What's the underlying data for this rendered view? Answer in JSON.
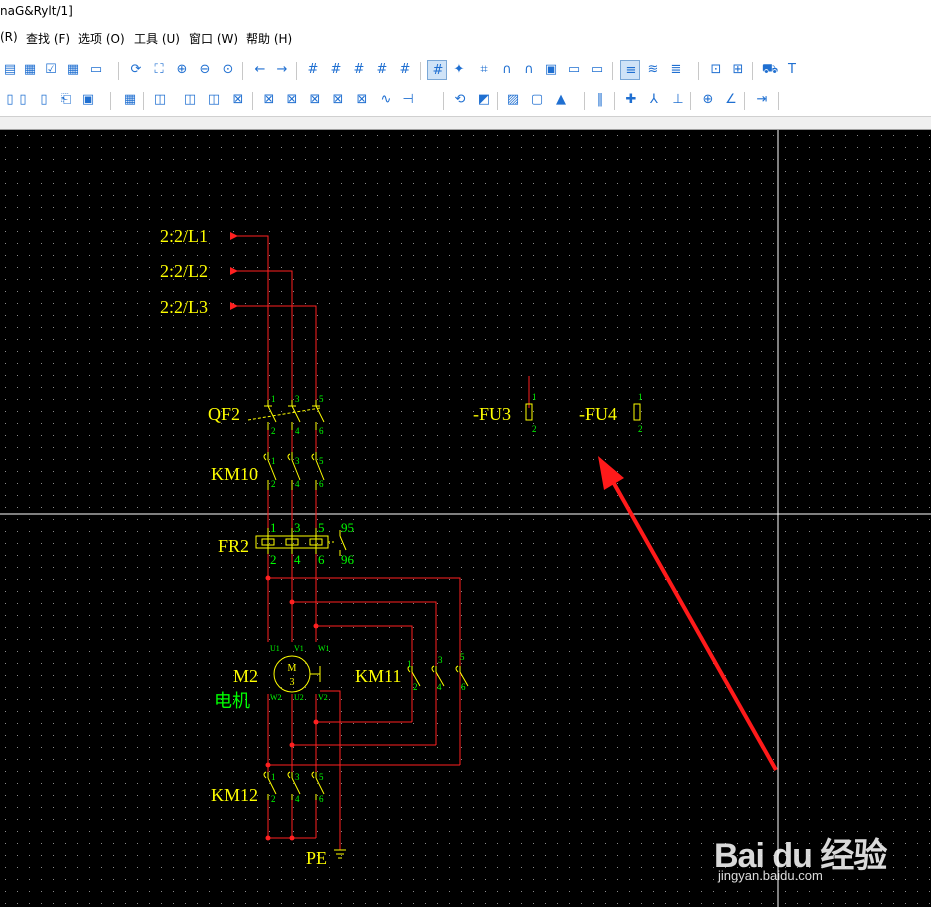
{
  "window": {
    "title": "naG&Rylt/1]"
  },
  "menu": {
    "items": [
      {
        "label": "(R)"
      },
      {
        "label": "查找 (F)"
      },
      {
        "label": "选项 (O)"
      },
      {
        "label": "工具 (U)"
      },
      {
        "label": "窗口 (W)"
      },
      {
        "label": "帮助 (H)"
      }
    ]
  },
  "toolbar": {
    "accent": "#1f6fd1",
    "row1_icons": [
      "open-icon",
      "print-preview-icon",
      "check-icon",
      "table-icon",
      "window-icon",
      "refresh-icon",
      "zoom-fit-icon",
      "zoom-in-icon",
      "zoom-out-icon",
      "zoom-all-icon",
      "back-icon",
      "forward-icon",
      "grid-a-icon",
      "grid-b-icon",
      "grid-c-icon",
      "grid-d-icon",
      "grid-e-icon",
      "grid-toggle-icon",
      "snap-icon",
      "hash-icon",
      "magnet-icon",
      "magnet-on-icon",
      "component-icon",
      "number-icon",
      "line-icon",
      "hatch-icon",
      "text-style-icon",
      "list-icon",
      "select-icon",
      "connect-icon",
      "cart-icon",
      "text-icon"
    ],
    "row2_icons": [
      "new-page-icon",
      "page-props-icon",
      "page-copy-icon",
      "page-export-icon",
      "symbol-icon",
      "symbol-lib-icon",
      "circuit1-icon",
      "circuit2-icon",
      "circuit3-icon",
      "device1-icon",
      "device2-icon",
      "device3-icon",
      "device4-icon",
      "device5-icon",
      "device6-icon",
      "green-wave-icon",
      "bridge-icon",
      "arrow-connect-icon",
      "fill-icon",
      "hatch-fill-icon",
      "box-icon",
      "terminal-icon",
      "bus-icon",
      "cross-icon",
      "branch-icon",
      "tap-icon",
      "junction-icon",
      "angle-icon",
      "green-line-icon"
    ]
  },
  "schematic": {
    "colors": {
      "wire": "#ff2020",
      "label": "#ffff00",
      "pin": "#00ff00",
      "component": "#ffff00",
      "cursor": "#ffffff",
      "arrow": "#ff1a1a"
    },
    "refs": {
      "L1": "2:2/L1",
      "L2": "2:2/L2",
      "L3": "2:2/L3",
      "qf2": "QF2",
      "km10": "KM10",
      "fr2": "FR2",
      "fu3": "-FU3",
      "fu4": "-FU4",
      "m2": "M2",
      "m2_desc": "电机",
      "km11": "KM11",
      "km12": "KM12",
      "pe": "PE"
    },
    "pins": {
      "p1": "1",
      "p2": "2",
      "p3": "3",
      "p4": "4",
      "p5": "5",
      "p6": "6",
      "p95": "95",
      "p96": "96",
      "u1": "U1",
      "v1": "V1",
      "w1": "W1",
      "u2": "U2",
      "v2": "V2",
      "w2": "W2",
      "motor_m": "M",
      "motor_3": "3"
    }
  },
  "watermark": {
    "main": "Bai du 经验",
    "sub": "jingyan.baidu.com"
  }
}
